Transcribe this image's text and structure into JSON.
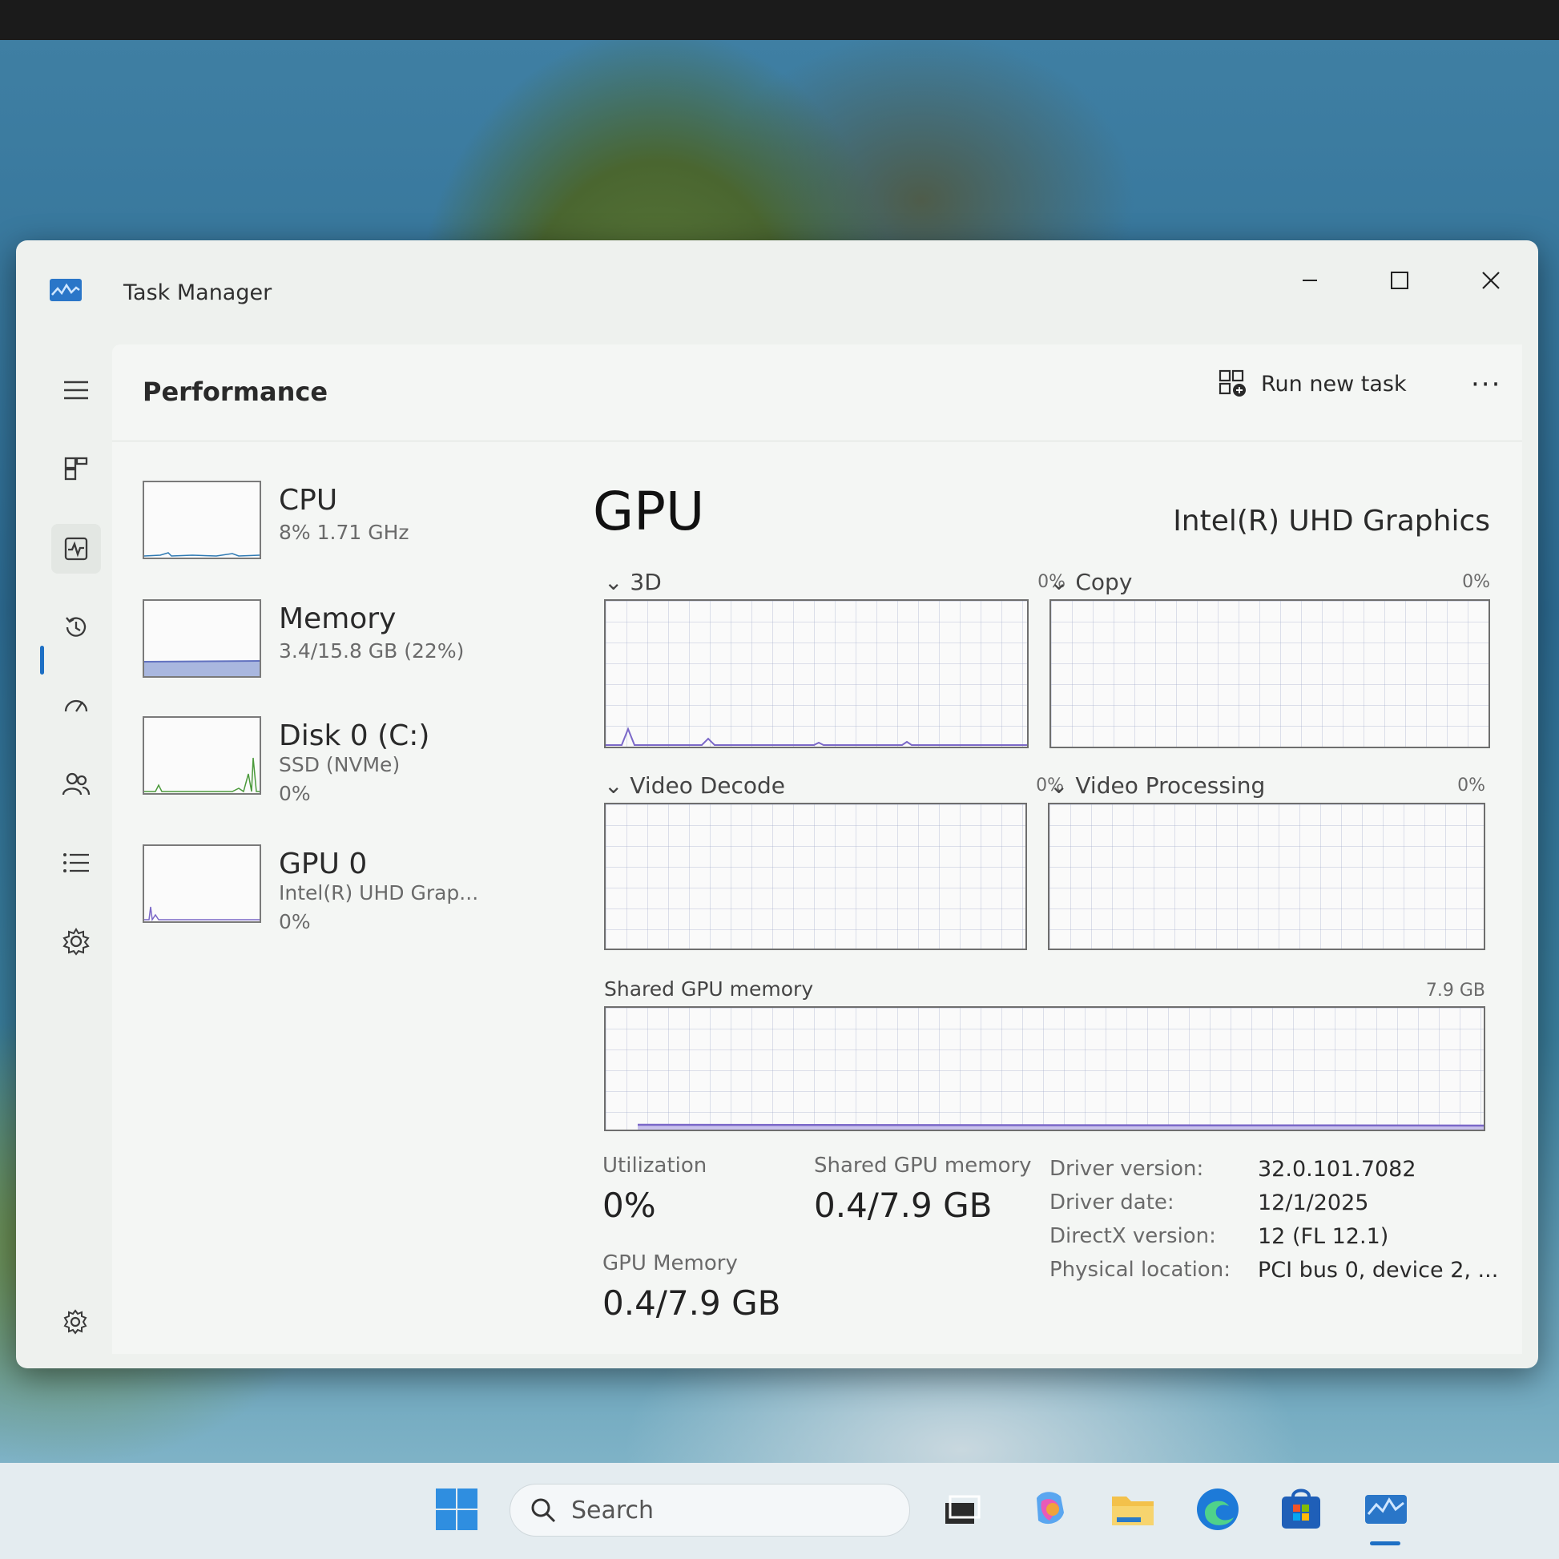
{
  "window": {
    "title": "Task Manager"
  },
  "header": {
    "title": "Performance",
    "run_new_task": "Run new task",
    "more": "···"
  },
  "resources": [
    {
      "name": "CPU",
      "line1": "8% 1.71 GHz",
      "line2": ""
    },
    {
      "name": "Memory",
      "line1": "3.4/15.8 GB (22%)",
      "line2": ""
    },
    {
      "name": "Disk 0 (C:)",
      "line1": "SSD (NVMe)",
      "line2": "0%"
    },
    {
      "name": "GPU 0",
      "line1": "Intel(R) UHD Grap...",
      "line2": "0%"
    }
  ],
  "gpu": {
    "title": "GPU",
    "model": "Intel(R) UHD Graphics",
    "engines": [
      {
        "label": "3D",
        "pct": "0%"
      },
      {
        "label": "Copy",
        "pct": "0%"
      },
      {
        "label": "Video Decode",
        "pct": "0%"
      },
      {
        "label": "Video Processing",
        "pct": "0%"
      }
    ],
    "shared_memory_graph": {
      "label": "Shared GPU memory",
      "max": "7.9 GB"
    },
    "stats": {
      "utilization_label": "Utilization",
      "utilization_value": "0%",
      "shared_label": "Shared GPU memory",
      "shared_value": "0.4/7.9 GB",
      "gpu_memory_label": "GPU Memory",
      "gpu_memory_value": "0.4/7.9 GB"
    },
    "details": [
      {
        "key": "Driver version:",
        "value": "32.0.101.7082"
      },
      {
        "key": "Driver date:",
        "value": "12/1/2025"
      },
      {
        "key": "DirectX version:",
        "value": "12 (FL 12.1)"
      },
      {
        "key": "Physical location:",
        "value": "PCI bus 0, device 2, ..."
      }
    ]
  },
  "taskbar": {
    "search_placeholder": "Search"
  },
  "colors": {
    "accent": "#1d6fc4",
    "graph_line": "#7b68c8",
    "memory_fill": "#a9b7df"
  }
}
